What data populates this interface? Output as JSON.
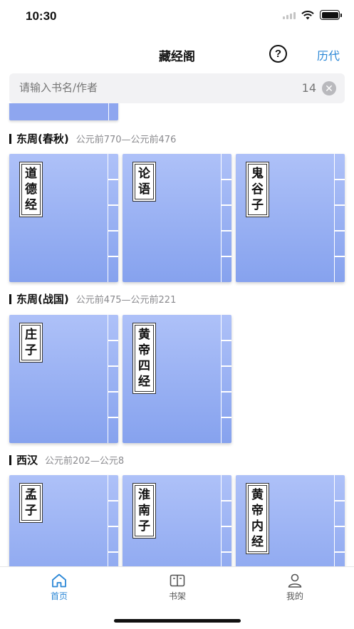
{
  "status": {
    "time": "10:30"
  },
  "nav": {
    "title": "藏经阁",
    "help_icon": "question-circle-icon",
    "right_link": "历代"
  },
  "search": {
    "placeholder": "请输入书名/作者",
    "count": "14",
    "clear_icon": "clear-icon"
  },
  "book_cover_color": "#8ea6ef",
  "accent_color": "#2b87d6",
  "sections": [
    {
      "name": "东周(春秋)",
      "range": "公元前770—公元前476",
      "books": [
        "道德经",
        "论语",
        "鬼谷子"
      ]
    },
    {
      "name": "东周(战国)",
      "range": "公元前475—公元前221",
      "books": [
        "庄子",
        "黄帝四经"
      ]
    },
    {
      "name": "西汉",
      "range": "公元前202—公元8",
      "books": [
        "孟子",
        "淮南子",
        "黄帝内经"
      ]
    }
  ],
  "tabs": [
    {
      "label": "首页",
      "icon": "home-icon",
      "active": true
    },
    {
      "label": "书架",
      "icon": "bookshelf-icon",
      "active": false
    },
    {
      "label": "我的",
      "icon": "user-icon",
      "active": false
    }
  ]
}
